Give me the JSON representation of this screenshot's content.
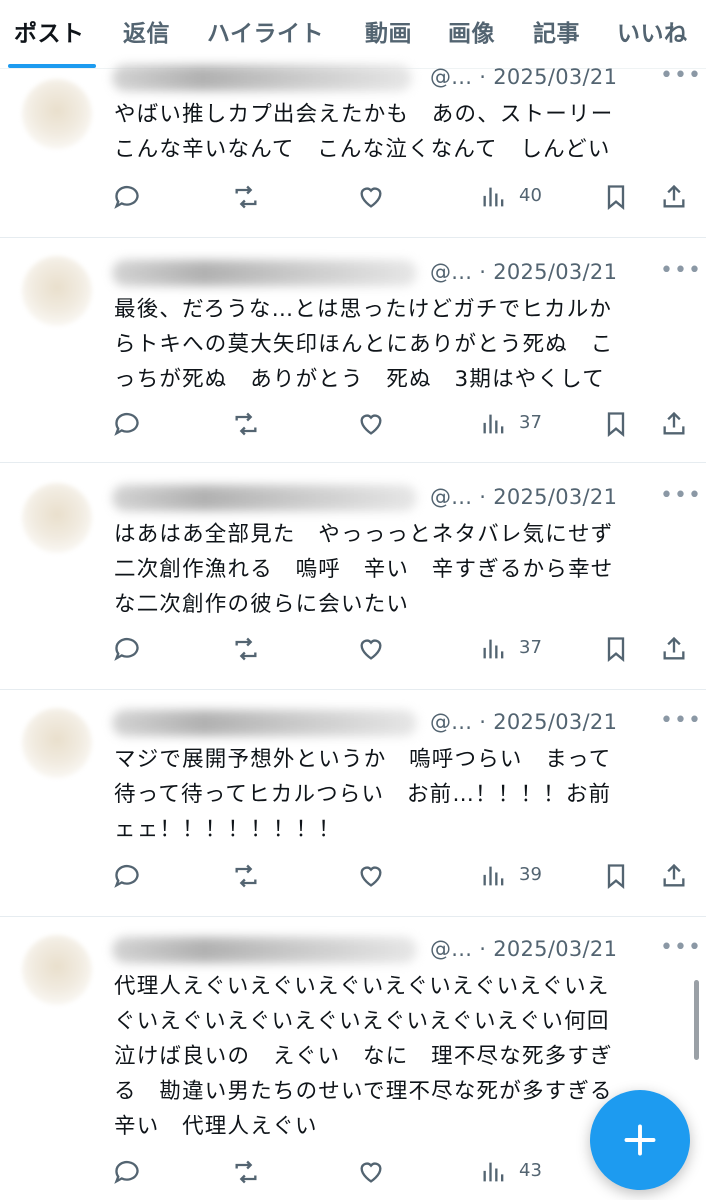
{
  "tabs": [
    "ポスト",
    "返信",
    "ハイライト",
    "動画",
    "画像",
    "記事",
    "いいね"
  ],
  "active_tab": "ポスト",
  "accent_color": "#1d9bf0",
  "posts": [
    {
      "handle": "@...",
      "separator": "·",
      "date": "2025/03/21",
      "text": "やばい推しカプ出会えたかも　あの、ストーリー\nこんな辛いなんて　こんな泣くなんて　しんどい",
      "views": "40"
    },
    {
      "handle": "@...",
      "separator": "·",
      "date": "2025/03/21",
      "text": "最後、だろうな…とは思ったけどガチでヒカルか\nらトキへの莫大矢印ほんとにありがとう死ぬ　こ\nっちが死ぬ　ありがとう　死ぬ　3期はやくして",
      "views": "37"
    },
    {
      "handle": "@...",
      "separator": "·",
      "date": "2025/03/21",
      "text": "はあはあ全部見た　やっっっとネタバレ気にせず\n二次創作漁れる　嗚呼　辛い　辛すぎるから幸せ\nな二次創作の彼らに会いたい",
      "views": "37"
    },
    {
      "handle": "@...",
      "separator": "·",
      "date": "2025/03/21",
      "text": "マジで展開予想外というか　嗚呼つらい　まって\n待って待ってヒカルつらい　お前…！！！！お前\nェェ！！！！！！！！",
      "views": "39"
    },
    {
      "handle": "@...",
      "separator": "·",
      "date": "2025/03/21",
      "text": "代理人えぐいえぐいえぐいえぐいえぐいえぐいえ\nぐいえぐいえぐいえぐいえぐいえぐいえぐい何回\n泣けば良いの　えぐい　なに　理不尽な死多すぎ\nる　勘違い男たちのせいで理不尽な死が多すぎる\n辛い　代理人えぐい",
      "views": "43"
    }
  ],
  "icons": {
    "reply": "reply-icon",
    "repost": "repost-icon",
    "like": "heart-icon",
    "views": "analytics-icon",
    "bookmark": "bookmark-icon",
    "share": "share-icon",
    "more": "more-icon",
    "compose": "plus-icon"
  }
}
